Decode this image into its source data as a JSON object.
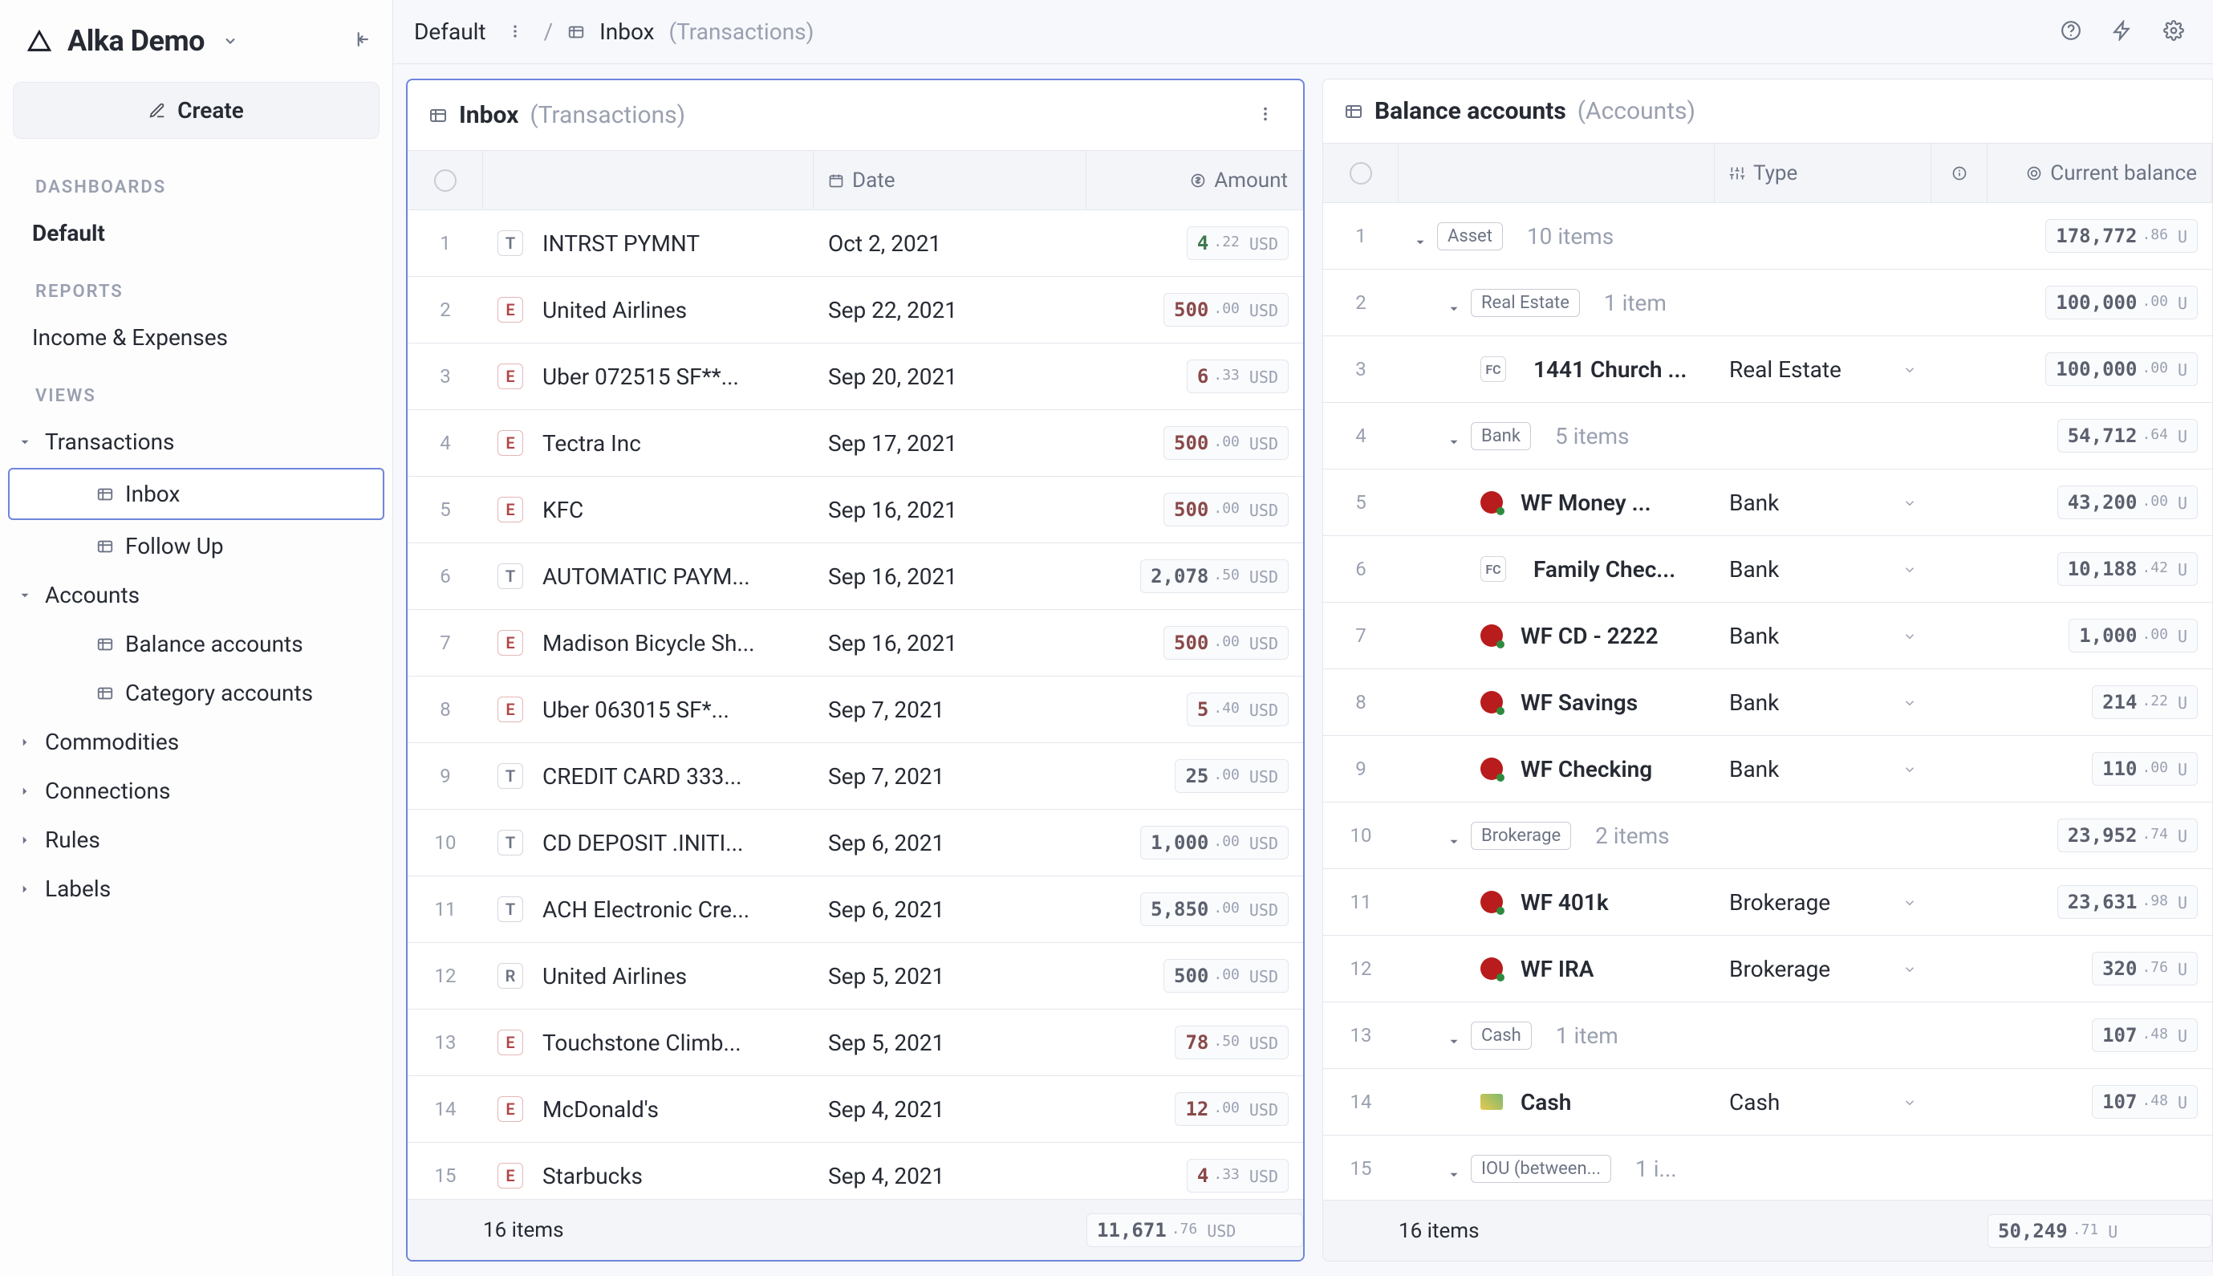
{
  "brand": "Alka Demo",
  "create_label": "Create",
  "sidebar": {
    "sections": {
      "dashboards": "DASHBOARDS",
      "reports": "REPORTS",
      "views": "VIEWS"
    },
    "dashboards": [
      {
        "label": "Default",
        "active": true
      }
    ],
    "reports": [
      {
        "label": "Income & Expenses"
      }
    ],
    "views": {
      "transactions": {
        "label": "Transactions",
        "children": [
          {
            "label": "Inbox",
            "selected": true
          },
          {
            "label": "Follow Up"
          }
        ]
      },
      "accounts": {
        "label": "Accounts",
        "children": [
          {
            "label": "Balance accounts"
          },
          {
            "label": "Category accounts"
          }
        ]
      }
    },
    "extras": [
      {
        "label": "Commodities"
      },
      {
        "label": "Connections"
      },
      {
        "label": "Rules"
      },
      {
        "label": "Labels"
      }
    ]
  },
  "breadcrumb": {
    "root": "Default",
    "leaf": "Inbox",
    "leaf_sub": "(Transactions)"
  },
  "panel_left": {
    "title": "Inbox",
    "title_sub": "(Transactions)",
    "columns": {
      "date": "Date",
      "amount": "Amount"
    },
    "rows": [
      {
        "n": "1",
        "badge": "T",
        "badge_gray": true,
        "name": "INTRST PYMNT",
        "date": "Oct 2, 2021",
        "int": "4",
        "cents": ".22",
        "cur": "USD",
        "tone": "pos"
      },
      {
        "n": "2",
        "badge": "E",
        "name": "United Airlines",
        "date": "Sep 22, 2021",
        "int": "500",
        "cents": ".00",
        "cur": "USD",
        "tone": "neg"
      },
      {
        "n": "3",
        "badge": "E",
        "name": "Uber 072515 SF**...",
        "date": "Sep 20, 2021",
        "int": "6",
        "cents": ".33",
        "cur": "USD",
        "tone": "neg"
      },
      {
        "n": "4",
        "badge": "E",
        "name": "Tectra Inc",
        "date": "Sep 17, 2021",
        "int": "500",
        "cents": ".00",
        "cur": "USD",
        "tone": "neg"
      },
      {
        "n": "5",
        "badge": "E",
        "name": "KFC",
        "date": "Sep 16, 2021",
        "int": "500",
        "cents": ".00",
        "cur": "USD",
        "tone": "neg"
      },
      {
        "n": "6",
        "badge": "T",
        "badge_gray": true,
        "name": "AUTOMATIC PAYM...",
        "date": "Sep 16, 2021",
        "int": "2,078",
        "cents": ".50",
        "cur": "USD",
        "tone": "neu"
      },
      {
        "n": "7",
        "badge": "E",
        "name": "Madison Bicycle Sh...",
        "date": "Sep 16, 2021",
        "int": "500",
        "cents": ".00",
        "cur": "USD",
        "tone": "neg"
      },
      {
        "n": "8",
        "badge": "E",
        "name": "Uber 063015 SF*...",
        "date": "Sep 7, 2021",
        "int": "5",
        "cents": ".40",
        "cur": "USD",
        "tone": "neg"
      },
      {
        "n": "9",
        "badge": "T",
        "badge_gray": true,
        "name": "CREDIT CARD 333...",
        "date": "Sep 7, 2021",
        "int": "25",
        "cents": ".00",
        "cur": "USD",
        "tone": "neu"
      },
      {
        "n": "10",
        "badge": "T",
        "badge_gray": true,
        "name": "CD DEPOSIT .INITI...",
        "date": "Sep 6, 2021",
        "int": "1,000",
        "cents": ".00",
        "cur": "USD",
        "tone": "neu"
      },
      {
        "n": "11",
        "badge": "T",
        "badge_gray": true,
        "name": "ACH Electronic Cre...",
        "date": "Sep 6, 2021",
        "int": "5,850",
        "cents": ".00",
        "cur": "USD",
        "tone": "neu"
      },
      {
        "n": "12",
        "badge": "R",
        "badge_gray": true,
        "name": "United Airlines",
        "date": "Sep 5, 2021",
        "int": "500",
        "cents": ".00",
        "cur": "USD",
        "tone": "neu"
      },
      {
        "n": "13",
        "badge": "E",
        "name": "Touchstone Climb...",
        "date": "Sep 5, 2021",
        "int": "78",
        "cents": ".50",
        "cur": "USD",
        "tone": "neg"
      },
      {
        "n": "14",
        "badge": "E",
        "name": "McDonald's",
        "date": "Sep 4, 2021",
        "int": "12",
        "cents": ".00",
        "cur": "USD",
        "tone": "neg"
      },
      {
        "n": "15",
        "badge": "E",
        "name": "Starbucks",
        "date": "Sep 4, 2021",
        "int": "4",
        "cents": ".33",
        "cur": "USD",
        "tone": "neg"
      }
    ],
    "footer_count": "16 items",
    "footer_amount": {
      "int": "11,671",
      "cents": ".76",
      "cur": "USD"
    }
  },
  "panel_right": {
    "title": "Balance accounts",
    "title_sub": "(Accounts)",
    "columns": {
      "type": "Type",
      "balance": "Current balance"
    },
    "rows": [
      {
        "n": "1",
        "kind": "group",
        "label": "Asset",
        "count": "10 items",
        "int": "178,772",
        "cents": ".86",
        "cur": "U"
      },
      {
        "n": "2",
        "kind": "group",
        "indent": 1,
        "label": "Real Estate",
        "count": "1 item",
        "int": "100,000",
        "cents": ".00",
        "cur": "U"
      },
      {
        "n": "3",
        "kind": "leaf",
        "indent": 2,
        "icon": "fc",
        "name": "1441 Church ...",
        "type": "Real Estate",
        "int": "100,000",
        "cents": ".00",
        "cur": "U"
      },
      {
        "n": "4",
        "kind": "group",
        "indent": 1,
        "label": "Bank",
        "count": "5 items",
        "int": "54,712",
        "cents": ".64",
        "cur": "U"
      },
      {
        "n": "5",
        "kind": "leaf",
        "indent": 2,
        "icon": "wf",
        "name": "WF Money ...",
        "type": "Bank",
        "int": "43,200",
        "cents": ".00",
        "cur": "U"
      },
      {
        "n": "6",
        "kind": "leaf",
        "indent": 2,
        "icon": "fc",
        "name": "Family Chec...",
        "type": "Bank",
        "int": "10,188",
        "cents": ".42",
        "cur": "U"
      },
      {
        "n": "7",
        "kind": "leaf",
        "indent": 2,
        "icon": "wf",
        "name": "WF CD - 2222",
        "type": "Bank",
        "int": "1,000",
        "cents": ".00",
        "cur": "U"
      },
      {
        "n": "8",
        "kind": "leaf",
        "indent": 2,
        "icon": "wf",
        "name": "WF Savings",
        "type": "Bank",
        "int": "214",
        "cents": ".22",
        "cur": "U"
      },
      {
        "n": "9",
        "kind": "leaf",
        "indent": 2,
        "icon": "wf",
        "name": "WF Checking",
        "type": "Bank",
        "int": "110",
        "cents": ".00",
        "cur": "U"
      },
      {
        "n": "10",
        "kind": "group",
        "indent": 1,
        "label": "Brokerage",
        "count": "2 items",
        "int": "23,952",
        "cents": ".74",
        "cur": "U"
      },
      {
        "n": "11",
        "kind": "leaf",
        "indent": 2,
        "icon": "wf",
        "name": "WF 401k",
        "type": "Brokerage",
        "int": "23,631",
        "cents": ".98",
        "cur": "U"
      },
      {
        "n": "12",
        "kind": "leaf",
        "indent": 2,
        "icon": "wf",
        "name": "WF IRA",
        "type": "Brokerage",
        "int": "320",
        "cents": ".76",
        "cur": "U"
      },
      {
        "n": "13",
        "kind": "group",
        "indent": 1,
        "label": "Cash",
        "count": "1 item",
        "int": "107",
        "cents": ".48",
        "cur": "U"
      },
      {
        "n": "14",
        "kind": "leaf",
        "indent": 2,
        "icon": "cash",
        "name": "Cash",
        "type": "Cash",
        "int": "107",
        "cents": ".48",
        "cur": "U"
      },
      {
        "n": "15",
        "kind": "group",
        "indent": 1,
        "label": "IOU (between...",
        "count": "1 i...",
        "int": "",
        "cents": "",
        "cur": ""
      }
    ],
    "footer_count": "16 items",
    "footer_amount": {
      "int": "50,249",
      "cents": ".71",
      "cur": "U"
    }
  }
}
